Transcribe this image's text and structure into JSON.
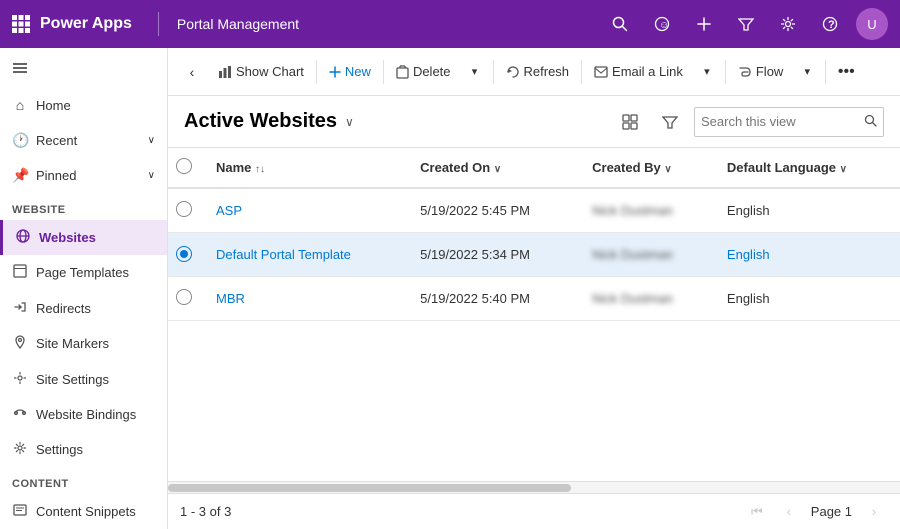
{
  "topNav": {
    "appName": "Power Apps",
    "appTitle": "Portal Management",
    "avatarInitial": "U"
  },
  "sidebar": {
    "menuLabel": "Menu",
    "topItems": [
      {
        "id": "home",
        "label": "Home",
        "icon": "⌂"
      },
      {
        "id": "recent",
        "label": "Recent",
        "icon": "🕐",
        "expandable": true
      },
      {
        "id": "pinned",
        "label": "Pinned",
        "icon": "📌",
        "expandable": true
      }
    ],
    "sections": [
      {
        "id": "website",
        "label": "Website",
        "items": [
          {
            "id": "websites",
            "label": "Websites",
            "icon": "🌐",
            "active": true
          },
          {
            "id": "page-templates",
            "label": "Page Templates",
            "icon": "📄"
          },
          {
            "id": "redirects",
            "label": "Redirects",
            "icon": "↩"
          },
          {
            "id": "site-markers",
            "label": "Site Markers",
            "icon": "📍"
          },
          {
            "id": "site-settings",
            "label": "Site Settings",
            "icon": "⚙"
          },
          {
            "id": "website-bindings",
            "label": "Website Bindings",
            "icon": "🔗"
          },
          {
            "id": "settings",
            "label": "Settings",
            "icon": "⚙"
          }
        ]
      },
      {
        "id": "content",
        "label": "Content",
        "items": [
          {
            "id": "content-snippets",
            "label": "Content Snippets",
            "icon": "✂"
          }
        ]
      }
    ]
  },
  "toolbar": {
    "backBtn": "‹",
    "showChartLabel": "Show Chart",
    "newLabel": "New",
    "deleteLabel": "Delete",
    "refreshLabel": "Refresh",
    "emailLinkLabel": "Email a Link",
    "flowLabel": "Flow",
    "moreOptions": "•••"
  },
  "viewHeader": {
    "title": "Active Websites",
    "searchPlaceholder": "Search this view"
  },
  "table": {
    "columns": [
      {
        "id": "name",
        "label": "Name",
        "sortable": true,
        "sortDir": "asc"
      },
      {
        "id": "createdOn",
        "label": "Created On",
        "sortable": true
      },
      {
        "id": "createdBy",
        "label": "Created By",
        "sortable": true
      },
      {
        "id": "defaultLanguage",
        "label": "Default Language",
        "sortable": true
      }
    ],
    "rows": [
      {
        "id": 1,
        "selected": false,
        "name": "ASP",
        "nameLink": true,
        "createdOn": "5/19/2022 5:45 PM",
        "createdBy": "Nick Dustman",
        "defaultLanguage": "English",
        "defaultLanguageLink": false,
        "rowHighlight": false
      },
      {
        "id": 2,
        "selected": true,
        "name": "Default Portal Template",
        "nameLink": true,
        "createdOn": "5/19/2022 5:34 PM",
        "createdBy": "Nick Dustman",
        "defaultLanguage": "English",
        "defaultLanguageLink": true,
        "rowHighlight": true
      },
      {
        "id": 3,
        "selected": false,
        "name": "MBR",
        "nameLink": true,
        "createdOn": "5/19/2022 5:40 PM",
        "createdBy": "Nick Dustman",
        "defaultLanguage": "English",
        "defaultLanguageLink": false,
        "rowHighlight": false
      }
    ]
  },
  "footer": {
    "countText": "1 - 3 of 3",
    "pageLabel": "Page 1"
  }
}
